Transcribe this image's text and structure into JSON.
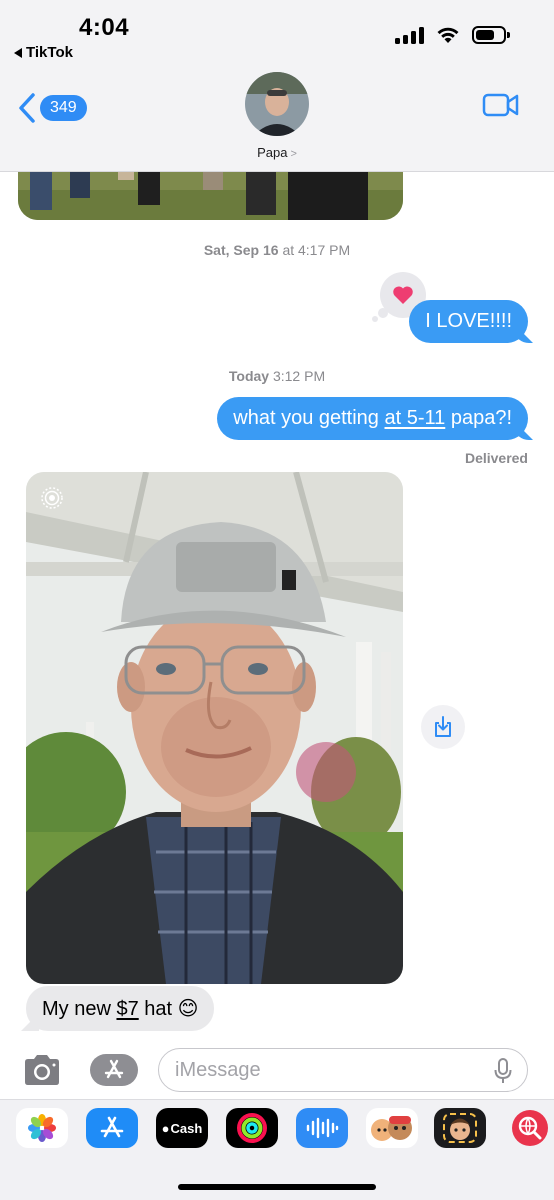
{
  "status_bar": {
    "time": "4:04",
    "back_app": "TikTok"
  },
  "header": {
    "unread_count": "349",
    "contact_name": "Papa",
    "contact_chevron": ">"
  },
  "messages": [
    {
      "type": "timestamp",
      "day": "Sat, Sep 16",
      "time": "at 4:17 PM"
    },
    {
      "type": "outgoing",
      "text": "I LOVE!!!!",
      "tapback": "heart"
    },
    {
      "type": "timestamp",
      "day": "Today",
      "time": "3:12 PM"
    },
    {
      "type": "outgoing",
      "text_before": "what you getting ",
      "text_link": "at 5-11",
      "text_after": " papa?!"
    },
    {
      "type": "status",
      "text": "Delivered"
    },
    {
      "type": "incoming",
      "text_before": "My new ",
      "text_link": "$7",
      "text_after": " hat 😊"
    }
  ],
  "input": {
    "placeholder": "iMessage"
  },
  "app_drawer": [
    {
      "name": "photos",
      "label": ""
    },
    {
      "name": "app-store",
      "label": ""
    },
    {
      "name": "apple-cash",
      "label": "Cash"
    },
    {
      "name": "activity",
      "label": ""
    },
    {
      "name": "audio-message",
      "label": ""
    },
    {
      "name": "memoji-stickers",
      "label": ""
    },
    {
      "name": "memoji",
      "label": ""
    },
    {
      "name": "images-search",
      "label": ""
    }
  ],
  "colors": {
    "accent": "#3a9bf4",
    "incoming_bubble": "#e9e9eb",
    "badge": "#2f8cf5",
    "tapback_heart": "#ee3d71"
  }
}
